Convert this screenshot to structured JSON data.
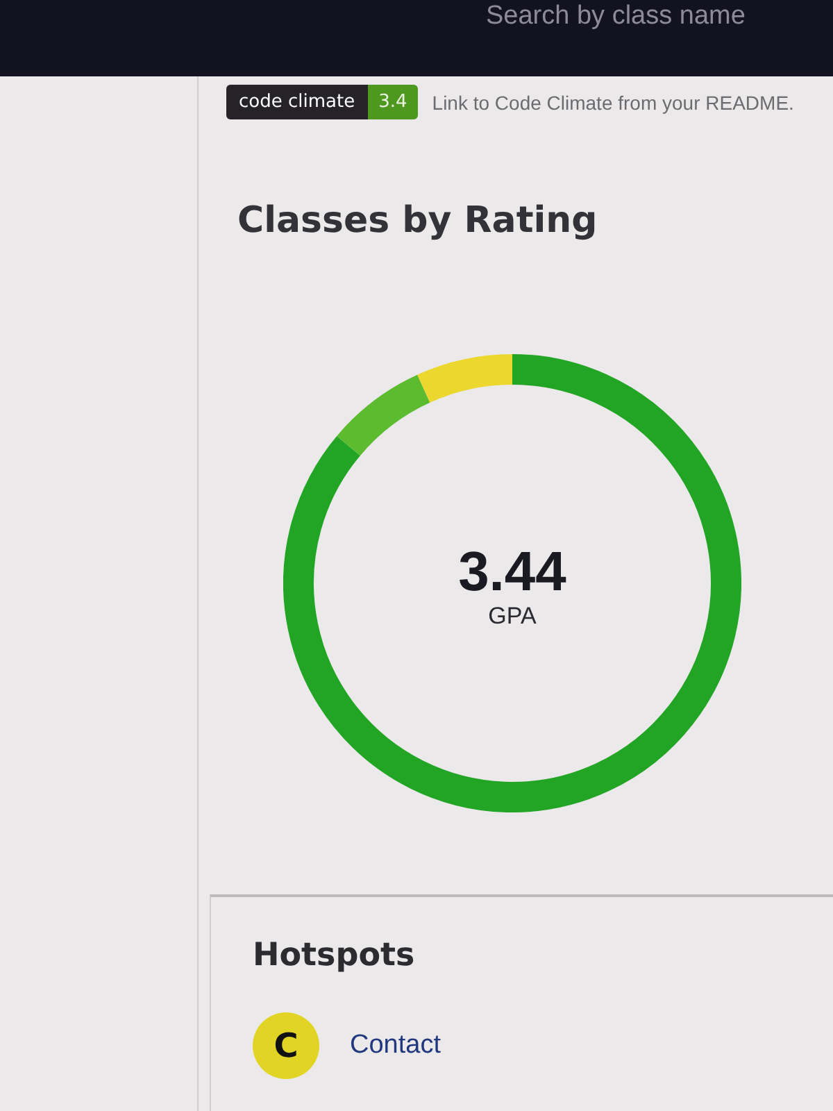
{
  "search": {
    "placeholder": "Search by class name"
  },
  "badge": {
    "label": "code climate",
    "value": "3.4"
  },
  "readme_link": "Link to Code Climate from your README.",
  "ratings": {
    "title": "Classes by Rating",
    "gpa": "3.44",
    "gpa_label": "GPA"
  },
  "hotspots": {
    "title": "Hotspots",
    "items": [
      {
        "grade": "C",
        "name": "Contact",
        "color": "#e2d424"
      }
    ]
  }
}
